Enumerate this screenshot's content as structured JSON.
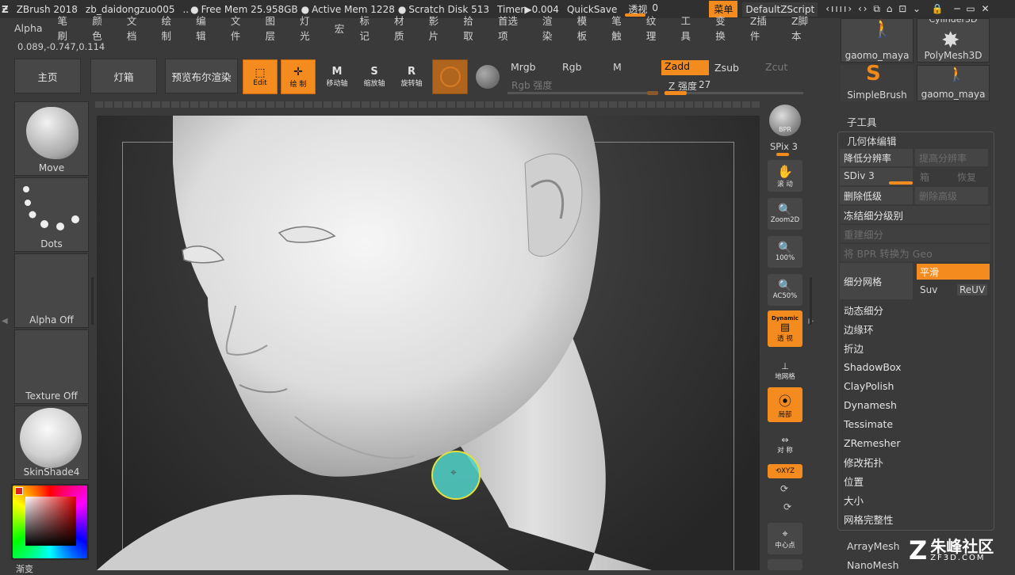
{
  "titlebar": {
    "app": "ZBrush 2018",
    "file": "zb_daidongzuo005",
    "ellipsis": "..",
    "free_mem": "Free Mem 25.958GB",
    "active_mem": "Active Mem 1228",
    "scratch": "Scratch Disk 513",
    "timer": "Timer▶0.004",
    "quicksave": "QuickSave",
    "perspective_label": "透视",
    "perspective_value": "0",
    "menu_button": "菜单",
    "script": "DefaultZScript"
  },
  "menubar": [
    "Alpha",
    "笔刷",
    "颜色",
    "文档",
    "绘制",
    "编辑",
    "文件",
    "图层",
    "灯光",
    "宏",
    "标记",
    "材质",
    "影片",
    "拾取",
    "首选项",
    "渲染",
    "模板",
    "笔触",
    "纹理",
    "工具",
    "变换",
    "Z插件",
    "Z脚本"
  ],
  "coords": "0.089,-0.747,0.114",
  "toolbar": {
    "home": "主页",
    "lightbox": "灯箱",
    "bpr_preview": "预览布尔渲染",
    "edit": "Edit",
    "draw": "绘 制",
    "move": "移动轴",
    "scale": "缩放轴",
    "rotate": "旋转轴",
    "mrgb": "Mrgb",
    "rgb": "Rgb",
    "m": "M",
    "rgb_intensity": "Rgb 强度",
    "zadd": "Zadd",
    "zsub": "Zsub",
    "zcut": "Zcut",
    "z_intensity_label": "Z 强度",
    "z_intensity_value": "27",
    "z_intensity_fraction": 0.27
  },
  "leftshelf": {
    "brush": "Move",
    "stroke": "Dots",
    "alpha": "Alpha Off",
    "texture": "Texture Off",
    "material": "SkinShade4",
    "gradient": "渐变"
  },
  "righttools": {
    "bpr": "BPR",
    "spix": "SPix 3",
    "scroll": "滚 动",
    "zoom2d": "Zoom2D",
    "hundred": "100%",
    "ac50": "AC50%",
    "dynamic": "Dynamic",
    "persp": "透 视",
    "floor": "地网格",
    "local": "局部",
    "sym": "对 称",
    "xyz": "XYZ",
    "center": "中心点"
  },
  "subtool_thumbs": [
    "Cylinder3D",
    "gaomo_maya",
    "PolyMesh3D",
    "SimpleBrush",
    "gaomo_maya"
  ],
  "panel": {
    "subtool": "子工具",
    "geometry": "几何体编辑",
    "lower_res": "降低分辨率",
    "higher_res": "提高分辨率",
    "sdiv": "SDiv 3",
    "cage": "箱",
    "restore": "恢复",
    "del_lower": "删除低级",
    "del_higher": "删除高级",
    "freeze": "冻结细分级别",
    "rebuild": "重建细分",
    "bpr_to_geo": "将 BPR 转换为 Geo",
    "divide": "细分网格",
    "smooth": "平滑",
    "suv": "Suv",
    "reuv": "ReUV",
    "items": [
      "动态细分",
      "边缘环",
      "折边",
      "ShadowBox",
      "ClayPolish",
      "Dynamesh",
      "Tessimate",
      "ZRemesher",
      "修改拓扑",
      "位置",
      "大小",
      "网格完整性"
    ],
    "arraymesh": "ArrayMesh",
    "nanomesh": "NanoMesh"
  },
  "watermark": {
    "cn": "朱峰社区",
    "url": "ZF3D.COM"
  }
}
